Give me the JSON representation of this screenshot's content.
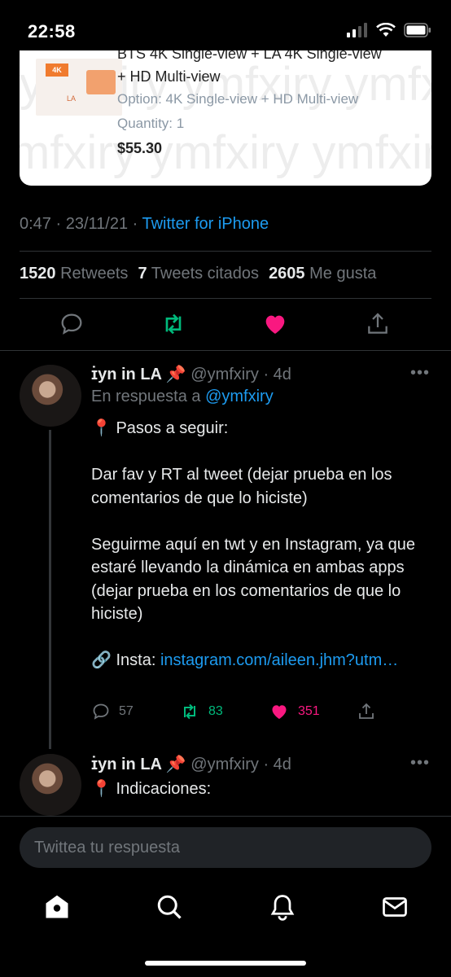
{
  "status_bar": {
    "time": "22:58"
  },
  "product": {
    "title_cut": "BTS 4K Single-view + LA 4K Single-view",
    "title_line2": "+ HD Multi-view",
    "option": "Option: 4K Single-view + HD Multi-view",
    "quantity": "Quantity: 1",
    "price": "$55.30",
    "watermark": "ymfxiry ymfxiry ymfxiry",
    "thumb_badge": "4K",
    "thumb_label": "LA"
  },
  "tweet_meta": {
    "timestamp": "0:47 · 23/11/21 · ",
    "source": "Twitter for iPhone"
  },
  "stats": [
    {
      "count": "1520",
      "label": "Retweets"
    },
    {
      "count": "7",
      "label": "Tweets citados"
    },
    {
      "count": "2605",
      "label": "Me gusta"
    }
  ],
  "colors": {
    "link": "#1d9bf0",
    "retweet": "#00ba7c",
    "like": "#f91880",
    "muted": "#71767b"
  },
  "replies": [
    {
      "name": "ɪ̇yn in LA 📌",
      "handle_time": "@ymfxiry · 4d",
      "more": "•••",
      "reply_to_prefix": "En respuesta a ",
      "reply_to_handle": "@ymfxiry",
      "paragraphs": [
        "📍 Pasos a seguir:",
        "Dar fav y RT al  tweet (dejar prueba en los comentarios de que lo hiciste)",
        "Seguirme aquí en twt y en Instagram, ya que estaré llevando la dinámica en ambas apps (dejar prueba en los comentarios de que lo hiciste)"
      ],
      "link_prefix": "🔗 Insta: ",
      "link_text": "instagram.com/aileen.jhm?utm…",
      "counts": {
        "replies": "57",
        "retweets": "83",
        "likes": "351"
      }
    },
    {
      "name": "ɪ̇yn in LA 📌",
      "handle_time": "@ymfxiry · 4d",
      "more": "•••",
      "preview": "📍 Indicaciones:"
    }
  ],
  "composer": {
    "placeholder": "Twittea tu respuesta"
  },
  "tabbar": {
    "items": [
      "home-icon",
      "search-icon",
      "notifications-icon",
      "messages-icon"
    ]
  }
}
